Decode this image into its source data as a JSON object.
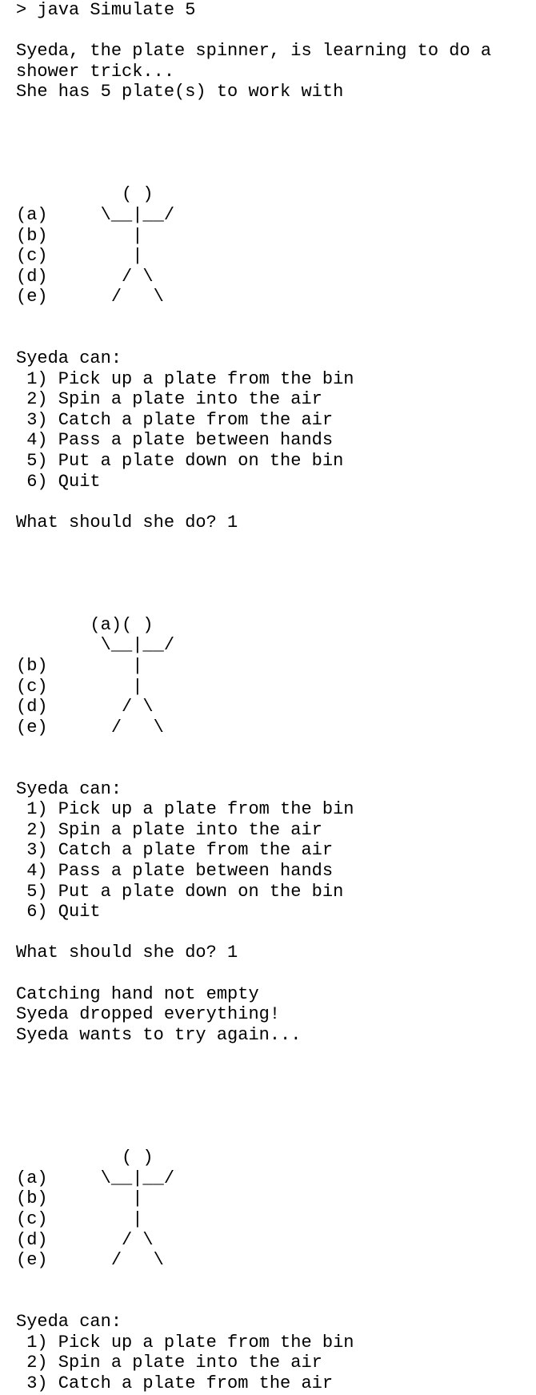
{
  "terminal": {
    "lines": [
      "> java Simulate 5",
      "",
      "Syeda, the plate spinner, is learning to do a",
      "shower trick...",
      "She has 5 plate(s) to work with",
      "",
      "",
      "",
      "",
      "          ( )",
      "(a)     \\__|__/",
      "(b)        |",
      "(c)        |",
      "(d)       / \\",
      "(e)      /   \\",
      "",
      "",
      "Syeda can:",
      " 1) Pick up a plate from the bin",
      " 2) Spin a plate into the air",
      " 3) Catch a plate from the air",
      " 4) Pass a plate between hands",
      " 5) Put a plate down on the bin",
      " 6) Quit",
      "",
      "What should she do? 1",
      "",
      "",
      "",
      "",
      "       (a)( )",
      "        \\__|__/",
      "(b)        |",
      "(c)        |",
      "(d)       / \\",
      "(e)      /   \\",
      "",
      "",
      "Syeda can:",
      " 1) Pick up a plate from the bin",
      " 2) Spin a plate into the air",
      " 3) Catch a plate from the air",
      " 4) Pass a plate between hands",
      " 5) Put a plate down on the bin",
      " 6) Quit",
      "",
      "What should she do? 1",
      "",
      "Catching hand not empty",
      "Syeda dropped everything!",
      "Syeda wants to try again...",
      "",
      "",
      "",
      "",
      "",
      "          ( )",
      "(a)     \\__|__/",
      "(b)        |",
      "(c)        |",
      "(d)       / \\",
      "(e)      /   \\",
      "",
      "",
      "Syeda can:",
      " 1) Pick up a plate from the bin",
      " 2) Spin a plate into the air",
      " 3) Catch a plate from the air"
    ]
  }
}
